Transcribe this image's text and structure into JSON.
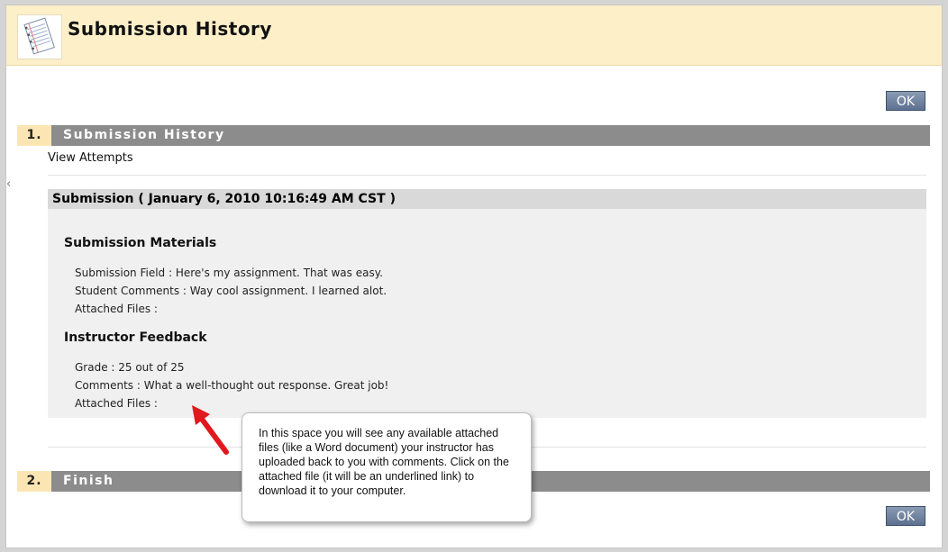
{
  "header": {
    "title": "Submission History",
    "icon": "notebook-paper-icon"
  },
  "buttons": {
    "ok_top": "OK",
    "ok_bottom": "OK"
  },
  "steps": [
    {
      "number": "1.",
      "label": "Submission History"
    },
    {
      "number": "2.",
      "label": "Finish"
    }
  ],
  "view_attempts": "View Attempts",
  "submission": {
    "heading": "Submission ( January 6, 2010 10:16:49 AM CST )",
    "materials": {
      "title": "Submission Materials",
      "lines": [
        "Submission Field : Here's my assignment. That was easy.",
        "Student Comments : Way cool assignment. I learned alot.",
        "Attached Files :"
      ]
    },
    "feedback": {
      "title": "Instructor Feedback",
      "lines": [
        "Grade : 25 out of 25",
        "Comments : What a well-thought out response. Great job!",
        "Attached Files :"
      ]
    }
  },
  "callout": {
    "text": "In this space you will see any available attached files (like a Word document) your instructor has uploaded back to you with comments. Click on the attached file (it will be an underlined link) to download it to your computer."
  },
  "colors": {
    "header_bg": "#fdefc8",
    "step_bar": "#8c8c8c",
    "step_number_bg": "#fbe6b3",
    "ok_button": "#6c7f9c",
    "arrow": "#e0191e"
  }
}
